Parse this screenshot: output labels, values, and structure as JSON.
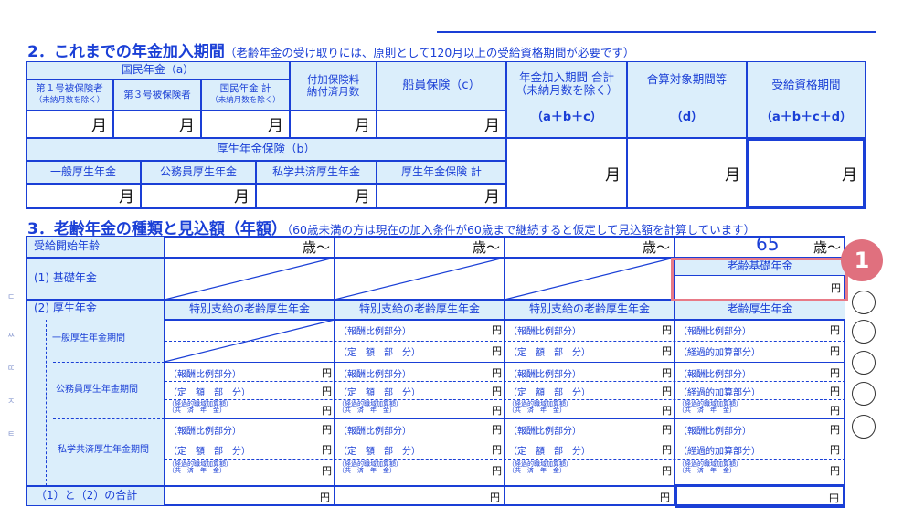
{
  "section2": {
    "title": "2．これまでの年金加入期間",
    "note": "（老齢年金の受け取りには、原則として120月以上の受給資格期間が必要です）",
    "national_pension": "国民年金（a）",
    "no1": "第１号被保険者",
    "no1_sub": "（未納月数を除く）",
    "no3": "第３号被保険者",
    "np_total": "国民年金 計",
    "np_total_sub": "（未納月数を除く）",
    "additional": "付加保険料\n納付済月数",
    "seaman": "船員保険（c）",
    "period_total": "年金加入期間 合計\n（未納月数を除く）",
    "period_total_formula": "（a＋b＋c）",
    "aggregate": "合算対象期間等",
    "aggregate_d": "（d）",
    "eligibility": "受給資格期間",
    "eligibility_formula": "（a＋b＋c＋d）",
    "welfare": "厚生年金保険（b）",
    "w_general": "一般厚生年金",
    "w_public": "公務員厚生年金",
    "w_private": "私学共済厚生年金",
    "w_total": "厚生年金保険 計",
    "month": "月"
  },
  "section3": {
    "title": "3．老齢年金の種類と見込額（年額）",
    "note": "（60歳未満の方は現在の加入条件が60歳まで継続すると仮定して見込額を計算しています）",
    "start_age": "受給開始年齢",
    "age_suffix": "歳～",
    "age_value": "65",
    "basic": "(1) 基礎年金",
    "basic_old": "老齢基礎年金",
    "welfare": "(2) 厚生年金",
    "special": "特別支給の老齢厚生年金",
    "old_welfare": "老齢厚生年金",
    "general_period": "一般厚生年金期間",
    "public_period": "公務員厚生年金期間",
    "private_period": "私学共済厚生年金期間",
    "remun": "（報酬比例部分）",
    "fixed": "（定　額　部　分）",
    "transitional": "（経過的加算部分）",
    "occupational": "（経過的職域加算額）\n（共　済　年　金）",
    "sum": "（1）と（2）の合計",
    "yen": "円"
  },
  "badge": "1",
  "side_marks": [
    "ㄷ",
    "ㅆ",
    "ㄸ",
    "ㅈ",
    "ㅌ"
  ]
}
